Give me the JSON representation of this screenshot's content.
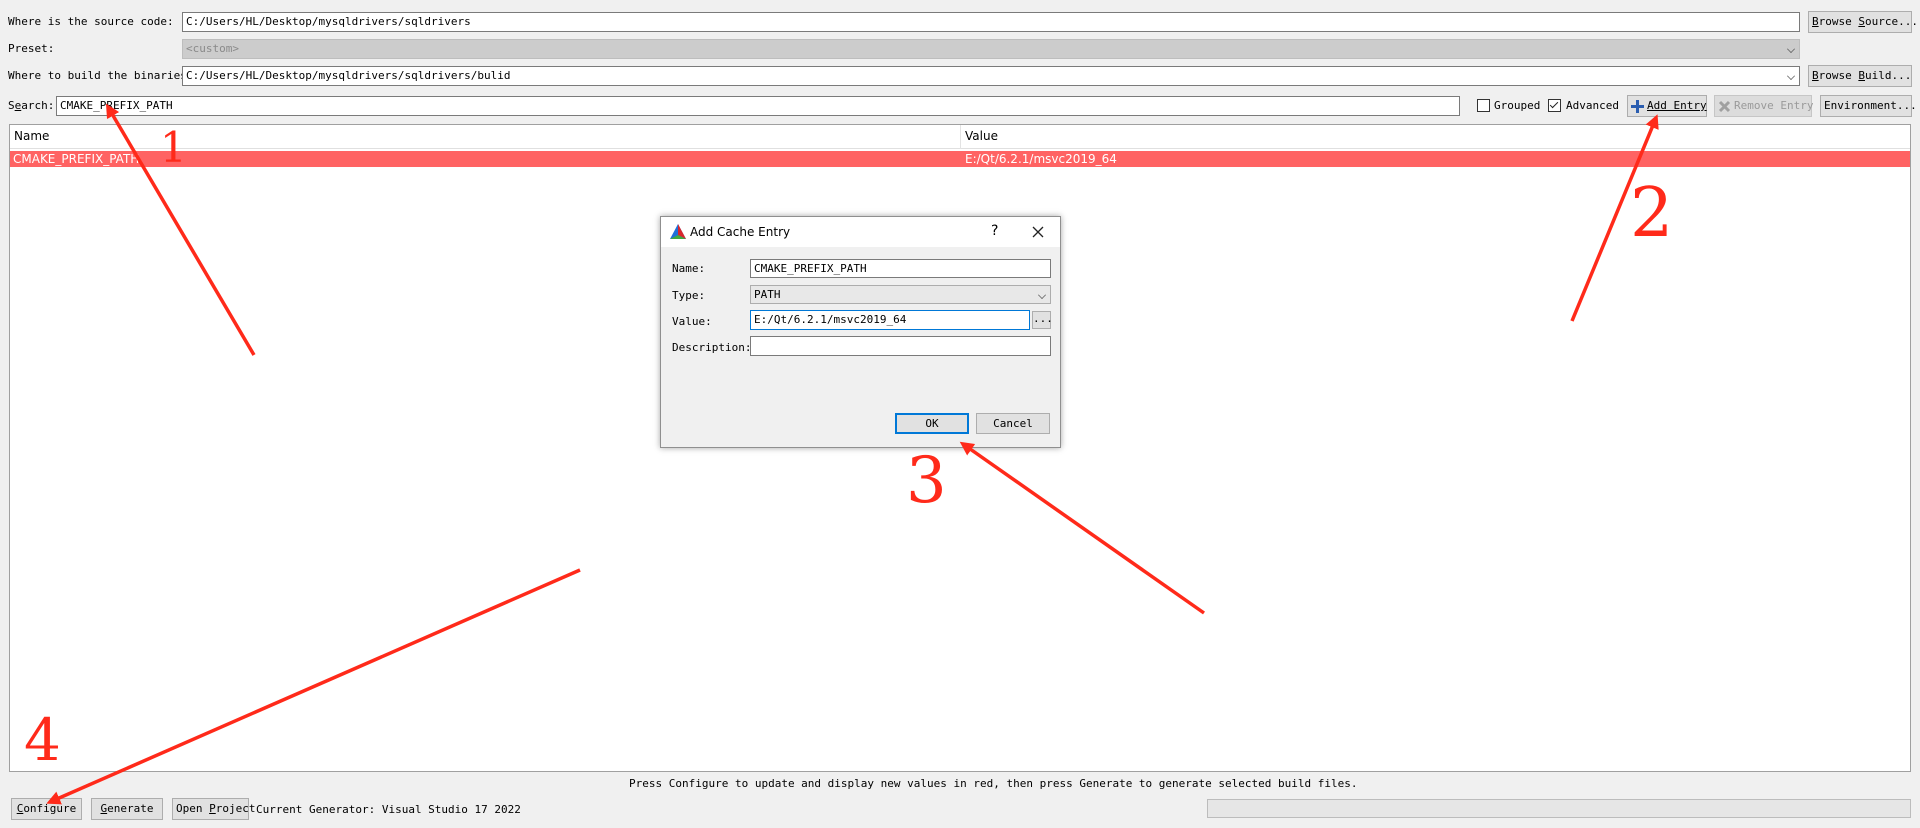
{
  "source": {
    "label": "Where is the source code:",
    "value": "C:/Users/HL/Desktop/mysqldrivers/sqldrivers",
    "browse": "Browse Source..."
  },
  "preset": {
    "label": "Preset:",
    "value": "<custom>"
  },
  "build": {
    "label": "Where to build the binaries:",
    "value": "C:/Users/HL/Desktop/mysqldrivers/sqldrivers/bulid",
    "browse": "Browse Build..."
  },
  "search": {
    "label": "Search:",
    "value": "CMAKE_PREFIX_PATH"
  },
  "options": {
    "grouped": "Grouped",
    "advanced": "Advanced"
  },
  "toolbar": {
    "add_entry": "Add Entry",
    "remove_entry": "Remove Entry",
    "environment": "Environment..."
  },
  "table": {
    "columns": [
      "Name",
      "Value"
    ],
    "rows": [
      {
        "name": "CMAKE_PREFIX_PATH",
        "value": "E:/Qt/6.2.1/msvc2019_64"
      }
    ]
  },
  "dialog": {
    "title": "Add Cache Entry",
    "help": "?",
    "name_label": "Name:",
    "name_value": "CMAKE_PREFIX_PATH",
    "type_label": "Type:",
    "type_value": "PATH",
    "value_label": "Value:",
    "value_value": "E:/Qt/6.2.1/msvc2019_64",
    "browse": "...",
    "description_label": "Description:",
    "description_value": "",
    "ok": "OK",
    "cancel": "Cancel"
  },
  "status": {
    "message": "Press Configure to update and display new values in red, then press Generate to generate selected build files.",
    "configure": "Configure",
    "generate": "Generate",
    "open_project": "Open Project",
    "generator": "Current Generator: Visual Studio 17 2022"
  },
  "annotations": [
    "1",
    "2",
    "3",
    "4"
  ],
  "colors": {
    "selected_row": "#ff6363",
    "annotation": "#ff2a1a",
    "focus": "#0078d7"
  }
}
